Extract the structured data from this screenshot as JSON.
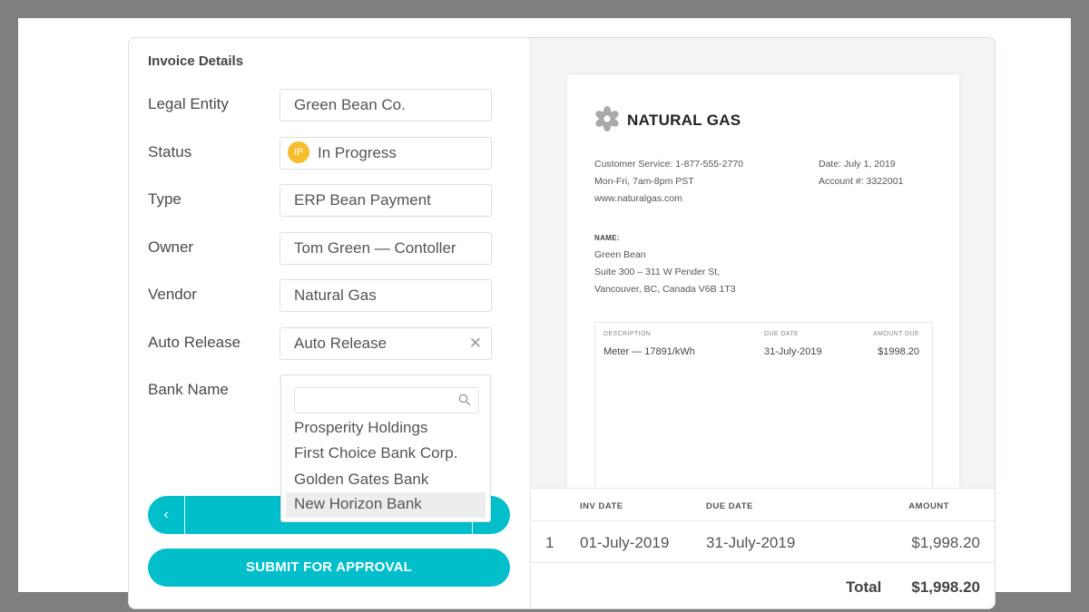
{
  "form": {
    "section_title": "Invoice Details",
    "fields": {
      "legal_entity": {
        "label": "Legal Entity",
        "value": "Green Bean Co."
      },
      "status": {
        "label": "Status",
        "badge": "IP",
        "value": "In Progress",
        "badge_color": "#f8bd2c"
      },
      "type": {
        "label": "Type",
        "value": "ERP Bean Payment"
      },
      "owner": {
        "label": "Owner",
        "value": "Tom Green — Contoller"
      },
      "vendor": {
        "label": "Vendor",
        "value": "Natural Gas"
      },
      "auto_release": {
        "label": "Auto Release",
        "value": "Auto Release",
        "clear_glyph": "✕"
      },
      "bank_name": {
        "label": "Bank Name"
      }
    },
    "bank_dropdown": {
      "search_placeholder": "",
      "options": [
        "Prosperity Holdings",
        "First Choice Bank Corp.",
        "Golden Gates Bank",
        "New Horizon Bank"
      ],
      "highlighted": "New Horizon Bank"
    },
    "pager": {
      "prev_glyph": "‹"
    },
    "submit_label": "SUBMIT FOR APPROVAL",
    "accent_color": "#00bfcb"
  },
  "invoice": {
    "vendor_name": "NATURAL GAS",
    "contact": [
      "Customer Service: 1-877-555-2770",
      "Mon-Fri, 7am-8pm PST",
      "www.naturalgas.com"
    ],
    "date": "Date: July 1, 2019",
    "account": "Account #: 3322001",
    "name_label": "NAME:",
    "address": [
      "Green Bean",
      "Suite 300 – 311 W Pender St,",
      "Vancouver, BC, Canada V6B 1T3"
    ],
    "table": {
      "headers": [
        "DESCRIPTION",
        "DUE DATE",
        "AMOUNT DUE"
      ],
      "rows": [
        [
          "Meter — 17891/kWh",
          "31-July-2019",
          "$1998.20"
        ]
      ]
    }
  },
  "summary": {
    "headers": [
      "INV DATE",
      "DUE  DATE",
      "AMOUNT"
    ],
    "rows": [
      {
        "index": "1",
        "inv_date": "01-July-2019",
        "due_date": "31-July-2019",
        "amount": "$1,998.20"
      }
    ],
    "total_label": "Total",
    "total_value": "$1,998.20"
  }
}
